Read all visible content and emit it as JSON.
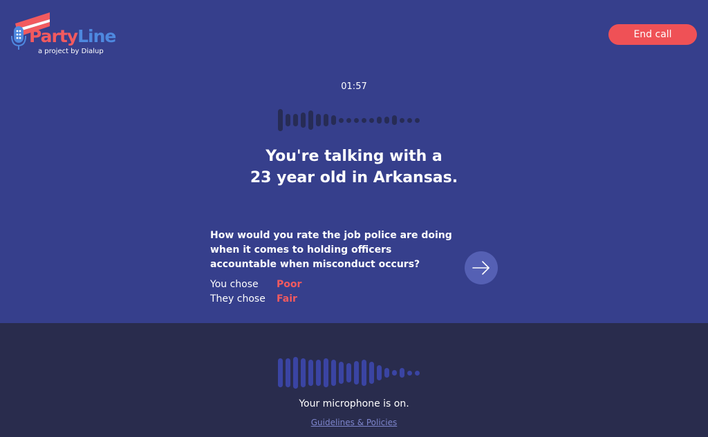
{
  "brand": {
    "name_part1": "Party",
    "name_part2": "Line",
    "tagline": "a project by Dialup",
    "colors": {
      "red": "#f25a5f",
      "blue": "#4e88df"
    }
  },
  "header": {
    "end_call_label": "End call"
  },
  "call": {
    "timer": "01:57",
    "headline_line1": "You're talking with a",
    "headline_line2": "23 year old in Arkansas."
  },
  "question": {
    "text": "How would you rate the job police are doing when it comes to holding officers accountable when misconduct occurs?",
    "you_label": "You chose",
    "you_value": "Poor",
    "they_label": "They chose",
    "they_value": "Fair",
    "next_icon": "arrow-right-icon"
  },
  "footer": {
    "mic_status": "Your microphone is on.",
    "guidelines_link": "Guidelines & Policies"
  },
  "waveform_top": [
    32,
    18,
    18,
    22,
    28,
    18,
    18,
    14,
    7,
    7,
    7,
    7,
    7,
    10,
    10,
    14,
    7,
    7,
    7
  ],
  "waveform_bottom": [
    42,
    42,
    46,
    42,
    38,
    38,
    42,
    38,
    32,
    28,
    34,
    38,
    32,
    22,
    14,
    8,
    14,
    7,
    7
  ],
  "colors": {
    "background_top": "#363f8c",
    "background_bottom": "#292c4d",
    "accent_red": "#ef5156"
  }
}
